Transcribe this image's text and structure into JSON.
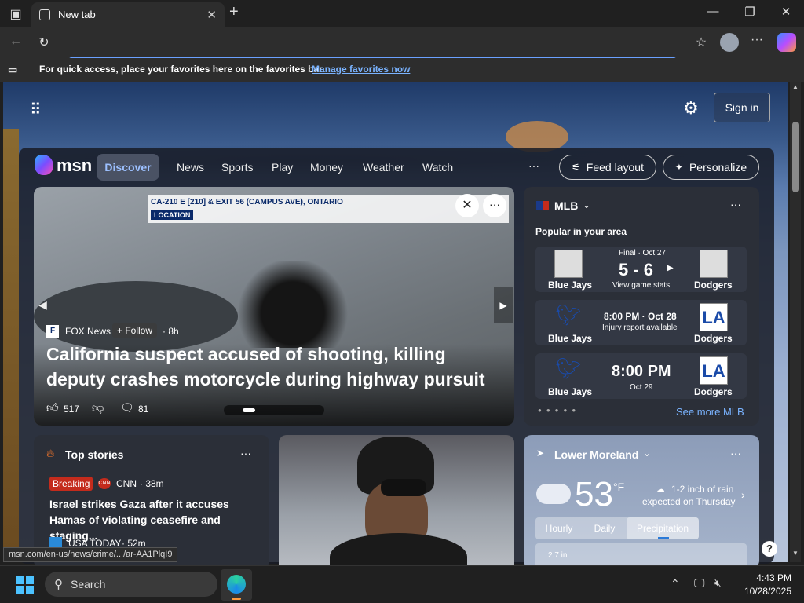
{
  "tab": {
    "title": "New tab"
  },
  "favbar": {
    "message": "For quick access, place your favorites here on the favorites bar.",
    "link": "Manage favorites now"
  },
  "header": {
    "sign_in": "Sign in"
  },
  "msn": {
    "logo": "msn",
    "nav": [
      "Discover",
      "News",
      "Sports",
      "Play",
      "Money",
      "Weather",
      "Watch"
    ],
    "more": "···",
    "feed_layout": "Feed layout",
    "personalize": "Personalize"
  },
  "hero": {
    "banner": "CA-210 E [210] & EXIT 56 (CAMPUS AVE), ONTARIO",
    "banner_sub": "LOCATION",
    "source": "FOX News",
    "follow": "+ Follow",
    "age": "· 8h",
    "headline": "California suspect accused of shooting, killing deputy crashes motorcycle during highway pursuit",
    "likes": "517",
    "comments": "81"
  },
  "mlb": {
    "title": "MLB",
    "subtitle": "Popular in your area",
    "games": [
      {
        "status": "Final · Oct 27",
        "score": "5 - 6",
        "sub": "View game stats",
        "home": "Blue Jays",
        "away": "Dodgers"
      },
      {
        "status": "8:00 PM · Oct 28",
        "score": "",
        "sub": "Injury report available",
        "home": "Blue Jays",
        "away": "Dodgers"
      },
      {
        "status": "",
        "score": "8:00 PM",
        "sub": "Oct 29",
        "home": "Blue Jays",
        "away": "Dodgers"
      }
    ],
    "see_more": "See more MLB"
  },
  "top_stories": {
    "title": "Top stories",
    "badge": "Breaking",
    "source1": "CNN",
    "age1": "· 38m",
    "headline1": "Israel strikes Gaza after it accuses Hamas of violating ceasefire and staging...",
    "source2": "USA TODAY",
    "age2": "· 52m"
  },
  "weather": {
    "location": "Lower Moreland",
    "temp": "53",
    "unit": "°F",
    "forecast1": "1-2 inch of rain",
    "forecast2": "expected on Thursday",
    "tabs": [
      "Hourly",
      "Daily",
      "Precipitation"
    ],
    "axis": "2.7 in"
  },
  "status_url": "msn.com/en-us/news/crime/.../ar-AA1PlqI9",
  "taskbar": {
    "search": "Search",
    "time": "4:43 PM",
    "date": "10/28/2025"
  },
  "colors": {
    "accent": "#6aa0ff",
    "breaking": "#c42b1c",
    "link": "#7ab3ff"
  }
}
